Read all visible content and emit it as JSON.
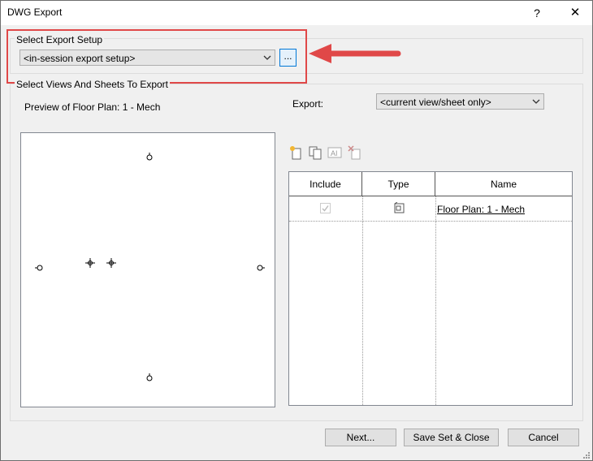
{
  "window": {
    "title": "DWG Export",
    "help_label": "?",
    "close_label": "✕"
  },
  "export_setup": {
    "group_label": "Select Export Setup",
    "selected": "<in-session export setup>",
    "browse_label": "..."
  },
  "views": {
    "group_label": "Select Views And Sheets To Export",
    "preview_label": "Preview of Floor Plan: 1 - Mech",
    "export_label": "Export:",
    "export_selected": "<current view/sheet only>"
  },
  "table": {
    "columns": [
      "Include",
      "Type",
      "Name"
    ],
    "rows": [
      {
        "name": "Floor Plan: 1 - Mech",
        "include": true
      }
    ]
  },
  "buttons": {
    "next": "Next...",
    "save_close": "Save Set & Close",
    "cancel": "Cancel"
  },
  "colors": {
    "highlight": "#e04848",
    "accent": "#0078d7"
  }
}
